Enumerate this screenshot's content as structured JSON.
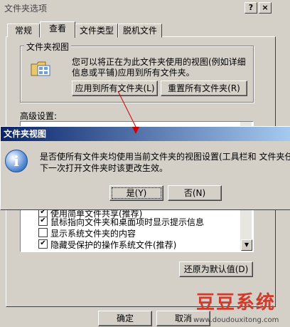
{
  "dialog": {
    "title": "文件夹选项",
    "help_btn": "?",
    "close_btn": "×",
    "tabs": [
      "常规",
      "查看",
      "文件类型",
      "脱机文件"
    ],
    "folder_views": {
      "legend": "文件夹视图",
      "description_line1": "您可以将正在为此文件夹使用的视图(例如详细",
      "description_line2": "信息或平铺)应用到所有文件夹。",
      "apply_all": "应用到所有文件夹(L)",
      "reset_all": "重置所有文件夹(R)"
    },
    "advanced_label": "高级设置:",
    "advanced_items": [
      {
        "label": "使用简单文件共享(推荐)",
        "checked": true
      },
      {
        "label": "鼠标指向文件夹和桌面项时显示提示信息",
        "checked": true
      },
      {
        "label": "显示系统文件夹的内容",
        "checked": false
      },
      {
        "label": "隐藏受保护的操作系统文件(推荐)",
        "checked": true
      }
    ],
    "restore_defaults": "还原为默认值(D)",
    "ok": "确定",
    "cancel": "取消"
  },
  "message_box": {
    "title": "文件夹视图",
    "line1": "是否使所有文件夹均使用当前文件夹的视图设置(工具栏和 文件夹任",
    "line2": "下一次打开文件夹时该更改生效。",
    "yes": "是(Y)",
    "no": "否(N)",
    "icon": "info-icon"
  },
  "watermark": {
    "brand": "豆豆系统",
    "url": "www.doudouxitong.com"
  },
  "colors": {
    "face": "#d4d0c8",
    "titlebar_active": "#0a246a",
    "annotation_red": "#cc0000"
  }
}
